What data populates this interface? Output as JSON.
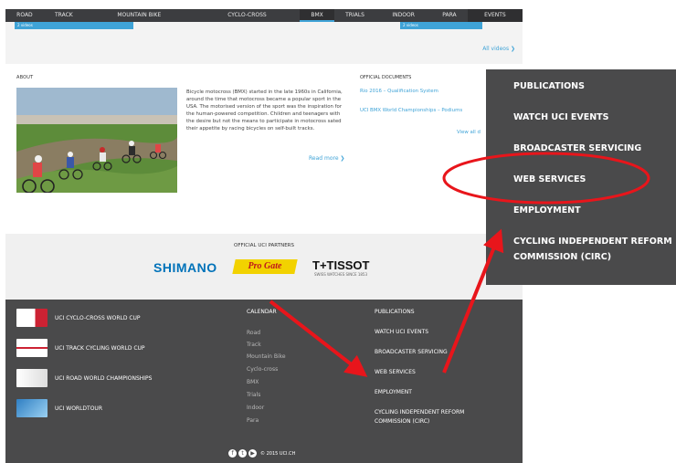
{
  "nav": {
    "items": [
      "ROAD",
      "TRACK",
      "MOUNTAIN BIKE",
      "CYCLO-CROSS",
      "BMX",
      "TRIALS",
      "INDOOR",
      "PARA",
      "EVENTS"
    ]
  },
  "videos": {
    "left_tab": "2 videos",
    "right_tab": "2 videos",
    "all_videos": "All videos ❯"
  },
  "about": {
    "label": "ABOUT",
    "text": "Bicycle motocross (BMX) started in the late 1960s in California, around the time that motocross became a popular sport in the USA. The motorised version of the sport was the inspiration for the human-powered competition. Children and teenagers with the desire but not the means to participate in motocross sated their appetite by racing bicycles on self-built tracks.",
    "read_more": "Read more ❯"
  },
  "docs": {
    "label": "OFFICIAL DOCUMENTS",
    "items": [
      "Rio 2016 – Qualification System",
      "UCI BMX World Championships – Podiums"
    ],
    "view_all": "View all d"
  },
  "partners": {
    "label": "OFFICIAL UCI PARTNERS",
    "shimano": "SHIMANO",
    "progate": "Pro Gate",
    "tissot": "T+TISSOT",
    "tissot_tag": "SWISS WATCHES SINCE 1853"
  },
  "footer": {
    "events": [
      "UCI CYCLO-CROSS WORLD CUP",
      "UCI TRACK CYCLING WORLD CUP",
      "UCI ROAD WORLD CHAMPIONSHIPS",
      "UCI WORLDTOUR"
    ],
    "calendar_title": "CALENDAR",
    "calendar": [
      "Road",
      "Track",
      "Mountain Bike",
      "Cyclo-cross",
      "BMX",
      "Trials",
      "Indoor",
      "Para"
    ],
    "links": [
      "PUBLICATIONS",
      "WATCH UCI EVENTS",
      "BROADCASTER SERVICING",
      "WEB SERVICES",
      "EMPLOYMENT",
      "CYCLING INDEPENDENT REFORM",
      "COMMISSION (CIRC)"
    ],
    "copyright": "© 2015 UCI.CH"
  },
  "popup": {
    "items": [
      "PUBLICATIONS",
      "WATCH UCI EVENTS",
      "BROADCASTER SERVICING",
      "WEB SERVICES",
      "EMPLOYMENT",
      "CYCLING INDEPENDENT REFORM",
      "COMMISSION (CIRC)"
    ]
  },
  "colors": {
    "nav_bg": "#3c3d40",
    "accent": "#3fa3d7",
    "footer_bg": "#4a4a4b",
    "annotation": "#e8151b"
  }
}
